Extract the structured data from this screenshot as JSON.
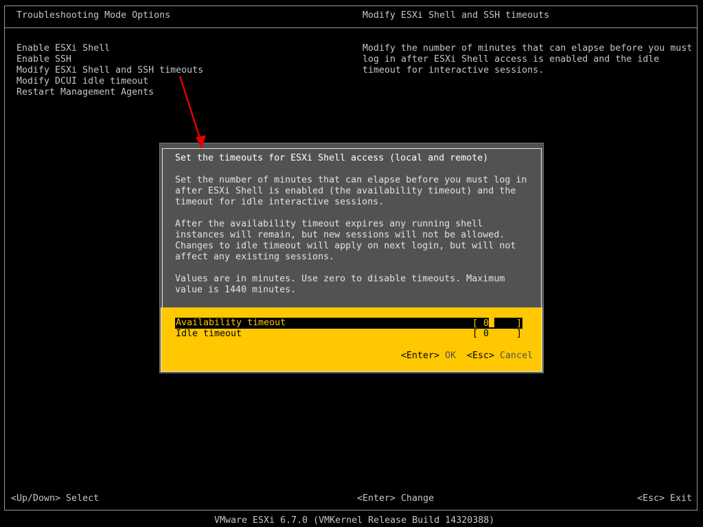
{
  "header": {
    "left_title": "Troubleshooting Mode Options",
    "right_title": "Modify ESXi Shell and SSH timeouts"
  },
  "menu": {
    "items": [
      {
        "label": "Enable ESXi Shell"
      },
      {
        "label": "Enable SSH"
      },
      {
        "label": "Modify ESXi Shell and SSH timeouts"
      },
      {
        "label": "Modify DCUI idle timeout"
      },
      {
        "label": "Restart Management Agents"
      }
    ]
  },
  "description": {
    "lines": [
      "Modify the number of minutes that can elapse before you must",
      "log in after ESXi Shell access is enabled and the idle",
      "timeout for interactive sessions."
    ]
  },
  "dialog": {
    "title": "Set the timeouts for ESXi Shell access (local and remote)",
    "body_lines": [
      "Set the number of minutes that can elapse before you must log in",
      "after ESXi Shell is enabled (the availability timeout) and the",
      "timeout for idle interactive sessions.",
      "",
      "After the availability timeout expires any running shell",
      "instances will remain, but new sessions will not be allowed.",
      "Changes to idle timeout will apply on next login, but will not",
      "affect any existing sessions.",
      "",
      "Values are in minutes. Use zero to disable timeouts. Maximum",
      "value is 1440 minutes."
    ],
    "fields": {
      "availability": {
        "label": "Availability timeout",
        "value": "0"
      },
      "idle": {
        "label": "Idle timeout",
        "value": "0"
      }
    },
    "buttons": {
      "ok": {
        "key": "<Enter>",
        "label": "OK"
      },
      "cancel": {
        "key": "<Esc>",
        "label": "Cancel"
      }
    }
  },
  "footer": {
    "left": "<Up/Down> Select",
    "center": "<Enter> Change",
    "right": "<Esc> Exit"
  },
  "version_bar": "VMware ESXi 6.7.0 (VMKernel Release Build 14320388)",
  "colors": {
    "background": "#000000",
    "text": "#c6c6c6",
    "dialog_bg": "#525252",
    "highlight": "#ffc800",
    "annotation_arrow": "#e00000"
  }
}
